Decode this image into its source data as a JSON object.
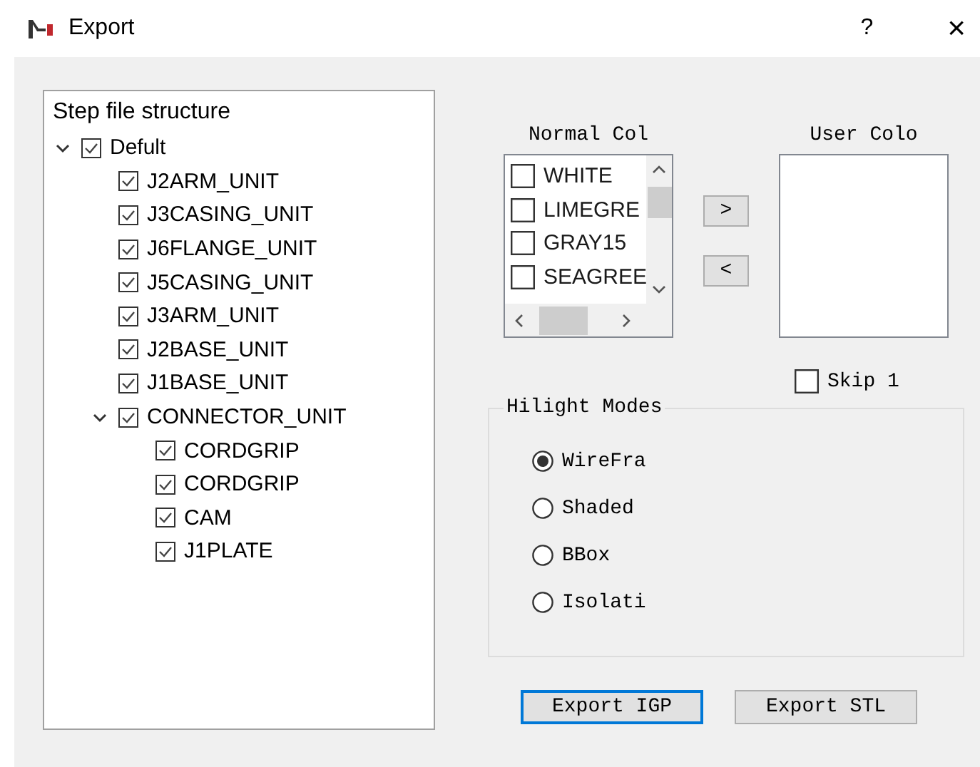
{
  "window": {
    "title": "Export",
    "help": "?",
    "close": "×"
  },
  "tree": {
    "title": "Step file structure",
    "items": [
      {
        "label": "Defult",
        "checked": true,
        "expanded": true,
        "children": [
          {
            "label": "J2ARM_UNIT",
            "checked": true
          },
          {
            "label": "J3CASING_UNIT",
            "checked": true
          },
          {
            "label": "J6FLANGE_UNIT",
            "checked": true
          },
          {
            "label": "J5CASING_UNIT",
            "checked": true
          },
          {
            "label": "J3ARM_UNIT",
            "checked": true
          },
          {
            "label": "J2BASE_UNIT",
            "checked": true
          },
          {
            "label": "J1BASE_UNIT",
            "checked": true
          },
          {
            "label": "CONNECTOR_UNIT",
            "checked": true,
            "expanded": true,
            "children": [
              {
                "label": "CORDGRIP",
                "checked": true
              },
              {
                "label": "CORDGRIP",
                "checked": true
              },
              {
                "label": "CAM",
                "checked": true
              },
              {
                "label": "J1PLATE",
                "checked": true
              }
            ]
          }
        ]
      }
    ]
  },
  "normal_colors": {
    "label": "Normal Col",
    "items": [
      {
        "label": "WHITE",
        "checked": false
      },
      {
        "label": "LIMEGRE",
        "checked": false
      },
      {
        "label": "GRAY15",
        "checked": false
      },
      {
        "label": "SEAGREE",
        "checked": false
      }
    ]
  },
  "move_buttons": [
    ">",
    "<"
  ],
  "user_colors": {
    "label": "User Colo"
  },
  "skip": {
    "label": "Skip 1",
    "checked": false
  },
  "hilight_modes": {
    "title": "Hilight Modes",
    "options": [
      {
        "label": "WireFra",
        "selected": true
      },
      {
        "label": "Shaded",
        "selected": false
      },
      {
        "label": "BBox",
        "selected": false
      },
      {
        "label": "Isolati",
        "selected": false
      }
    ]
  },
  "buttons": [
    {
      "label": "Export IGP",
      "default": true
    },
    {
      "label": "Export STL",
      "default": false
    }
  ]
}
